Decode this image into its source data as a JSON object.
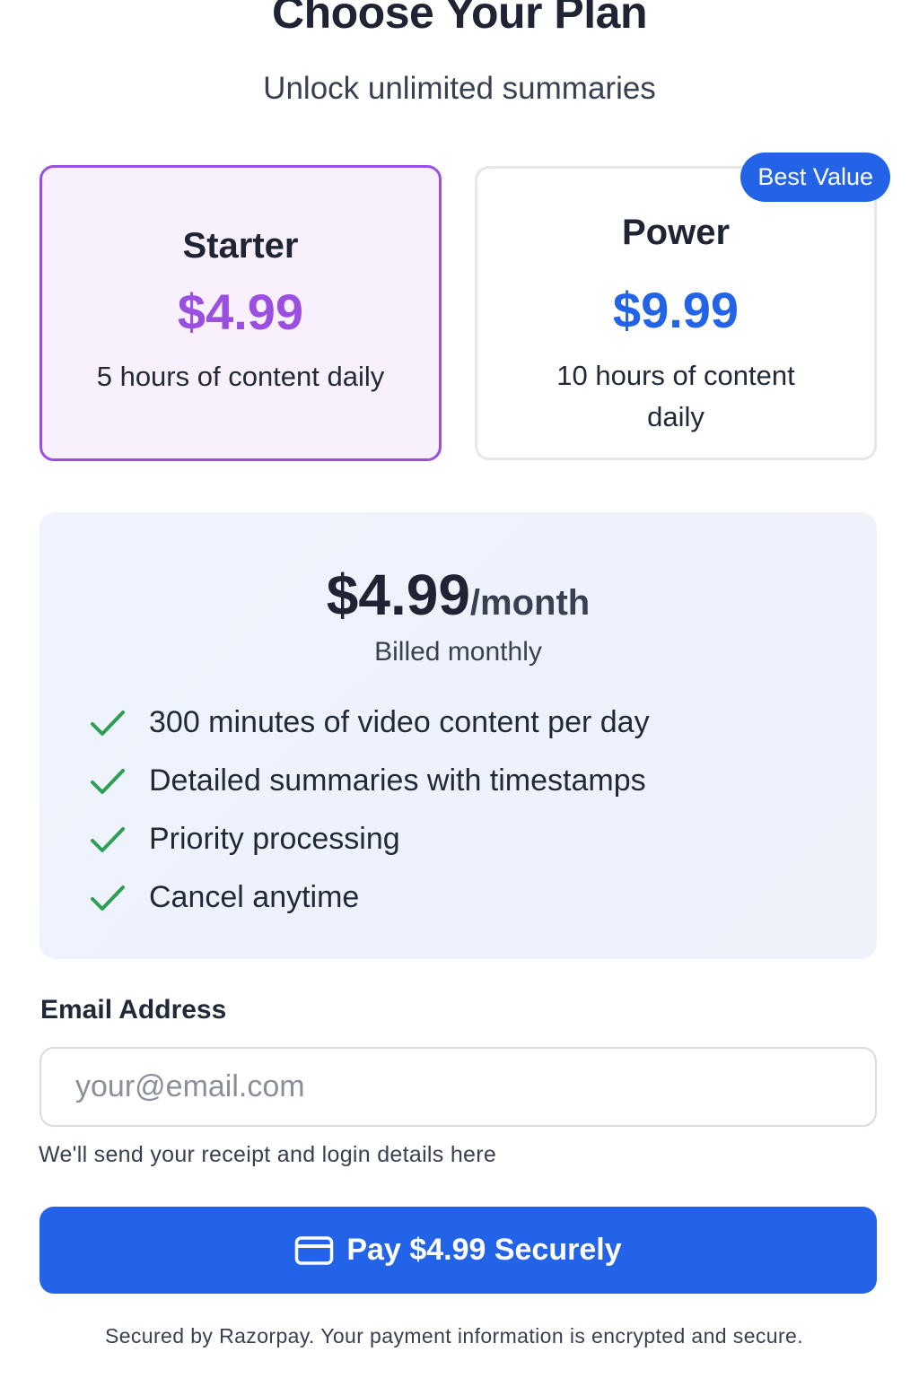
{
  "header": {
    "title": "Choose Your Plan",
    "subtitle": "Unlock unlimited summaries"
  },
  "plans": [
    {
      "name": "Starter",
      "price": "$4.99",
      "description": "5 hours of content daily",
      "selected": true,
      "accent_color": "#9b4fe0"
    },
    {
      "name": "Power",
      "price": "$9.99",
      "description": "10 hours of content daily",
      "badge": "Best Value",
      "selected": false,
      "accent_color": "#2263e8"
    }
  ],
  "summary": {
    "amount": "$4.99",
    "period": "/month",
    "billing_note": "Billed monthly",
    "features": [
      "300 minutes of video content per day",
      "Detailed summaries with timestamps",
      "Priority processing",
      "Cancel anytime"
    ],
    "feature_icon": "check-icon",
    "check_color": "#2f9e54"
  },
  "email": {
    "label": "Email Address",
    "placeholder": "your@email.com",
    "value": "",
    "help_text": "We'll send your receipt and login details here"
  },
  "pay_button": {
    "label": "Pay $4.99 Securely",
    "icon": "credit-card-icon",
    "color": "#2263e8"
  },
  "footer": {
    "secure_note": "Secured by Razorpay. Your payment information is encrypted and secure."
  }
}
